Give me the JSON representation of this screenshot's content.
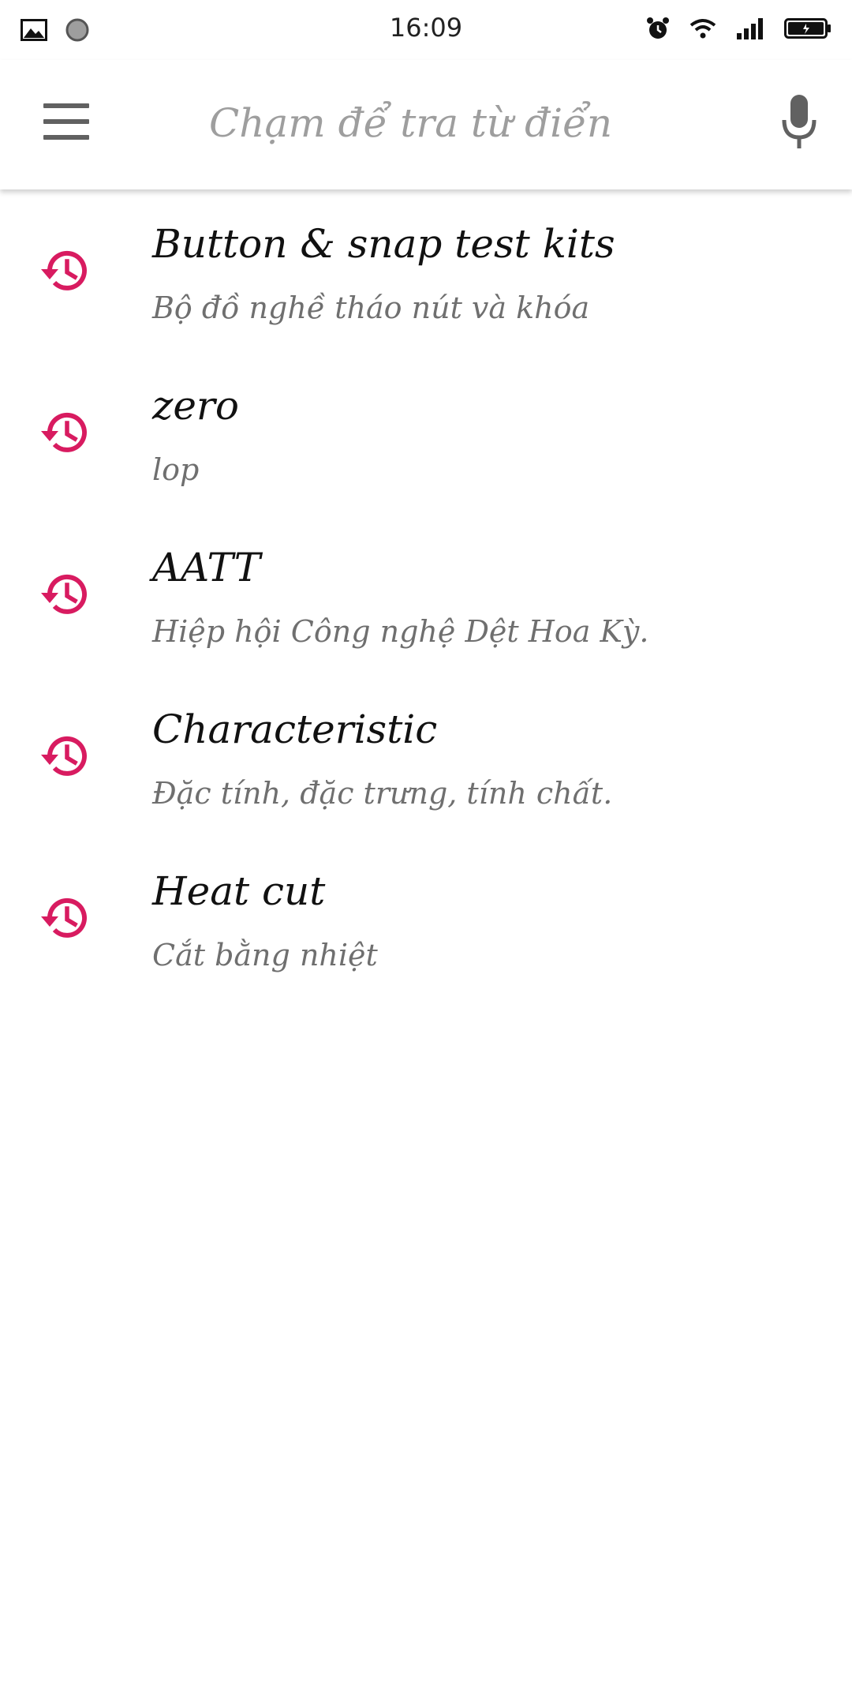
{
  "status_bar": {
    "time": "16:09",
    "left_icons": [
      "image-icon",
      "record-icon"
    ],
    "right_icons": [
      "alarm-icon",
      "wifi-icon",
      "signal-icon",
      "battery-icon"
    ]
  },
  "search": {
    "placeholder": "Chạm để tra từ điển",
    "value": ""
  },
  "history": [
    {
      "word": "Button & snap test kits",
      "meaning": "Bộ đồ nghề tháo nút và khóa"
    },
    {
      "word": "zero",
      "meaning": "lop"
    },
    {
      "word": "AATT",
      "meaning": "Hiệp hội Công nghệ Dệt Hoa Kỳ."
    },
    {
      "word": "Characteristic",
      "meaning": "Đặc tính, đặc trưng, tính chất."
    },
    {
      "word": "Heat cut",
      "meaning": "Cắt bằng nhiệt"
    }
  ],
  "colors": {
    "accent": "#d81b60",
    "toolbar_icon": "#616161",
    "placeholder": "#9e9e9e",
    "word_text": "#111111",
    "meaning_text": "#6f6f6f"
  }
}
